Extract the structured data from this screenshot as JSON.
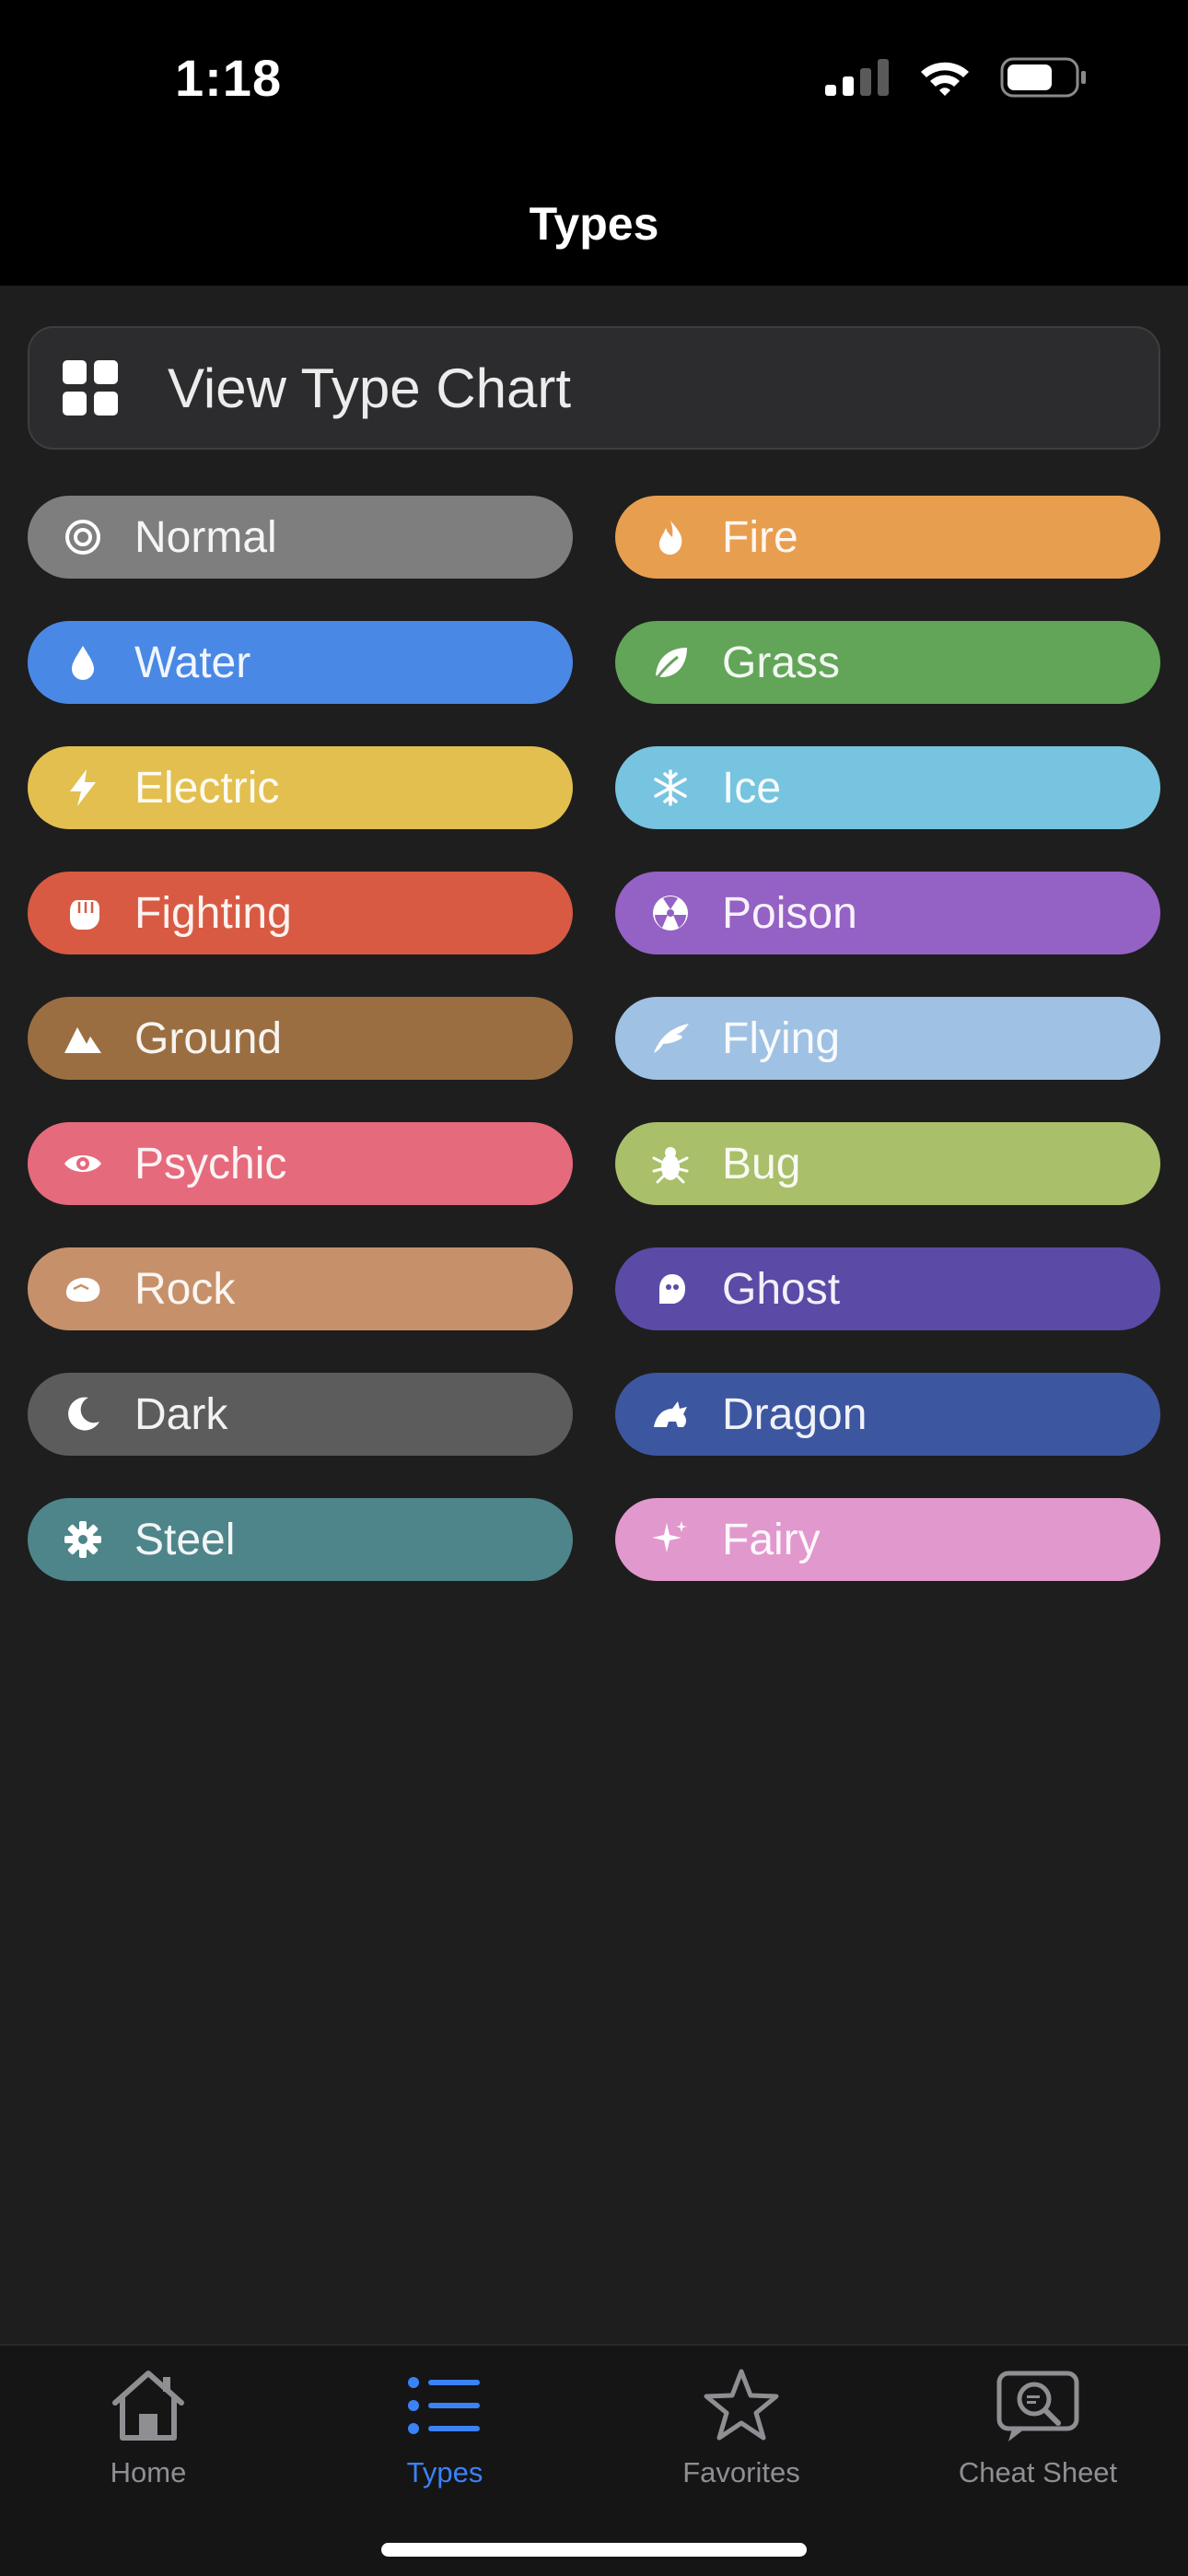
{
  "status_bar": {
    "time": "1:18",
    "icons": [
      "cellular-signal-icon",
      "wifi-icon",
      "battery-icon"
    ]
  },
  "nav": {
    "title": "Types"
  },
  "chart_button": {
    "label": "View Type Chart",
    "icon": "grid-icon"
  },
  "types": [
    {
      "id": "normal",
      "label": "Normal",
      "color": "#7e7e7e",
      "icon": "ring-icon"
    },
    {
      "id": "fire",
      "label": "Fire",
      "color": "#e89e4f",
      "icon": "flame-icon"
    },
    {
      "id": "water",
      "label": "Water",
      "color": "#4a88e6",
      "icon": "droplet-icon"
    },
    {
      "id": "grass",
      "label": "Grass",
      "color": "#62a559",
      "icon": "leaf-icon"
    },
    {
      "id": "electric",
      "label": "Electric",
      "color": "#e3bf4f",
      "icon": "bolt-icon"
    },
    {
      "id": "ice",
      "label": "Ice",
      "color": "#76c4df",
      "icon": "snowflake-icon"
    },
    {
      "id": "fighting",
      "label": "Fighting",
      "color": "#d85a43",
      "icon": "fist-icon"
    },
    {
      "id": "poison",
      "label": "Poison",
      "color": "#9461c4",
      "icon": "radiation-icon"
    },
    {
      "id": "ground",
      "label": "Ground",
      "color": "#9b6e41",
      "icon": "mountain-icon"
    },
    {
      "id": "flying",
      "label": "Flying",
      "color": "#9fc1e3",
      "icon": "wing-icon"
    },
    {
      "id": "psychic",
      "label": "Psychic",
      "color": "#e56a7c",
      "icon": "eye-icon"
    },
    {
      "id": "bug",
      "label": "Bug",
      "color": "#a9bf6a",
      "icon": "bug-icon"
    },
    {
      "id": "rock",
      "label": "Rock",
      "color": "#c6916a",
      "icon": "rock-icon"
    },
    {
      "id": "ghost",
      "label": "Ghost",
      "color": "#5b4aa6",
      "icon": "ghost-icon"
    },
    {
      "id": "dark",
      "label": "Dark",
      "color": "#5c5c5c",
      "icon": "moon-icon"
    },
    {
      "id": "dragon",
      "label": "Dragon",
      "color": "#3d56a0",
      "icon": "dragon-icon"
    },
    {
      "id": "steel",
      "label": "Steel",
      "color": "#4e858a",
      "icon": "gear-icon"
    },
    {
      "id": "fairy",
      "label": "Fairy",
      "color": "#e198cd",
      "icon": "sparkle-icon"
    }
  ],
  "tabbar": {
    "active_color": "#3b82f6",
    "inactive_color": "#8e8e93",
    "items": [
      {
        "id": "home",
        "label": "Home",
        "icon": "house-icon",
        "active": false
      },
      {
        "id": "types",
        "label": "Types",
        "icon": "list-icon",
        "active": true
      },
      {
        "id": "favorites",
        "label": "Favorites",
        "icon": "star-icon",
        "active": false
      },
      {
        "id": "cheat-sheet",
        "label": "Cheat Sheet",
        "icon": "chat-search-icon",
        "active": false
      }
    ]
  }
}
